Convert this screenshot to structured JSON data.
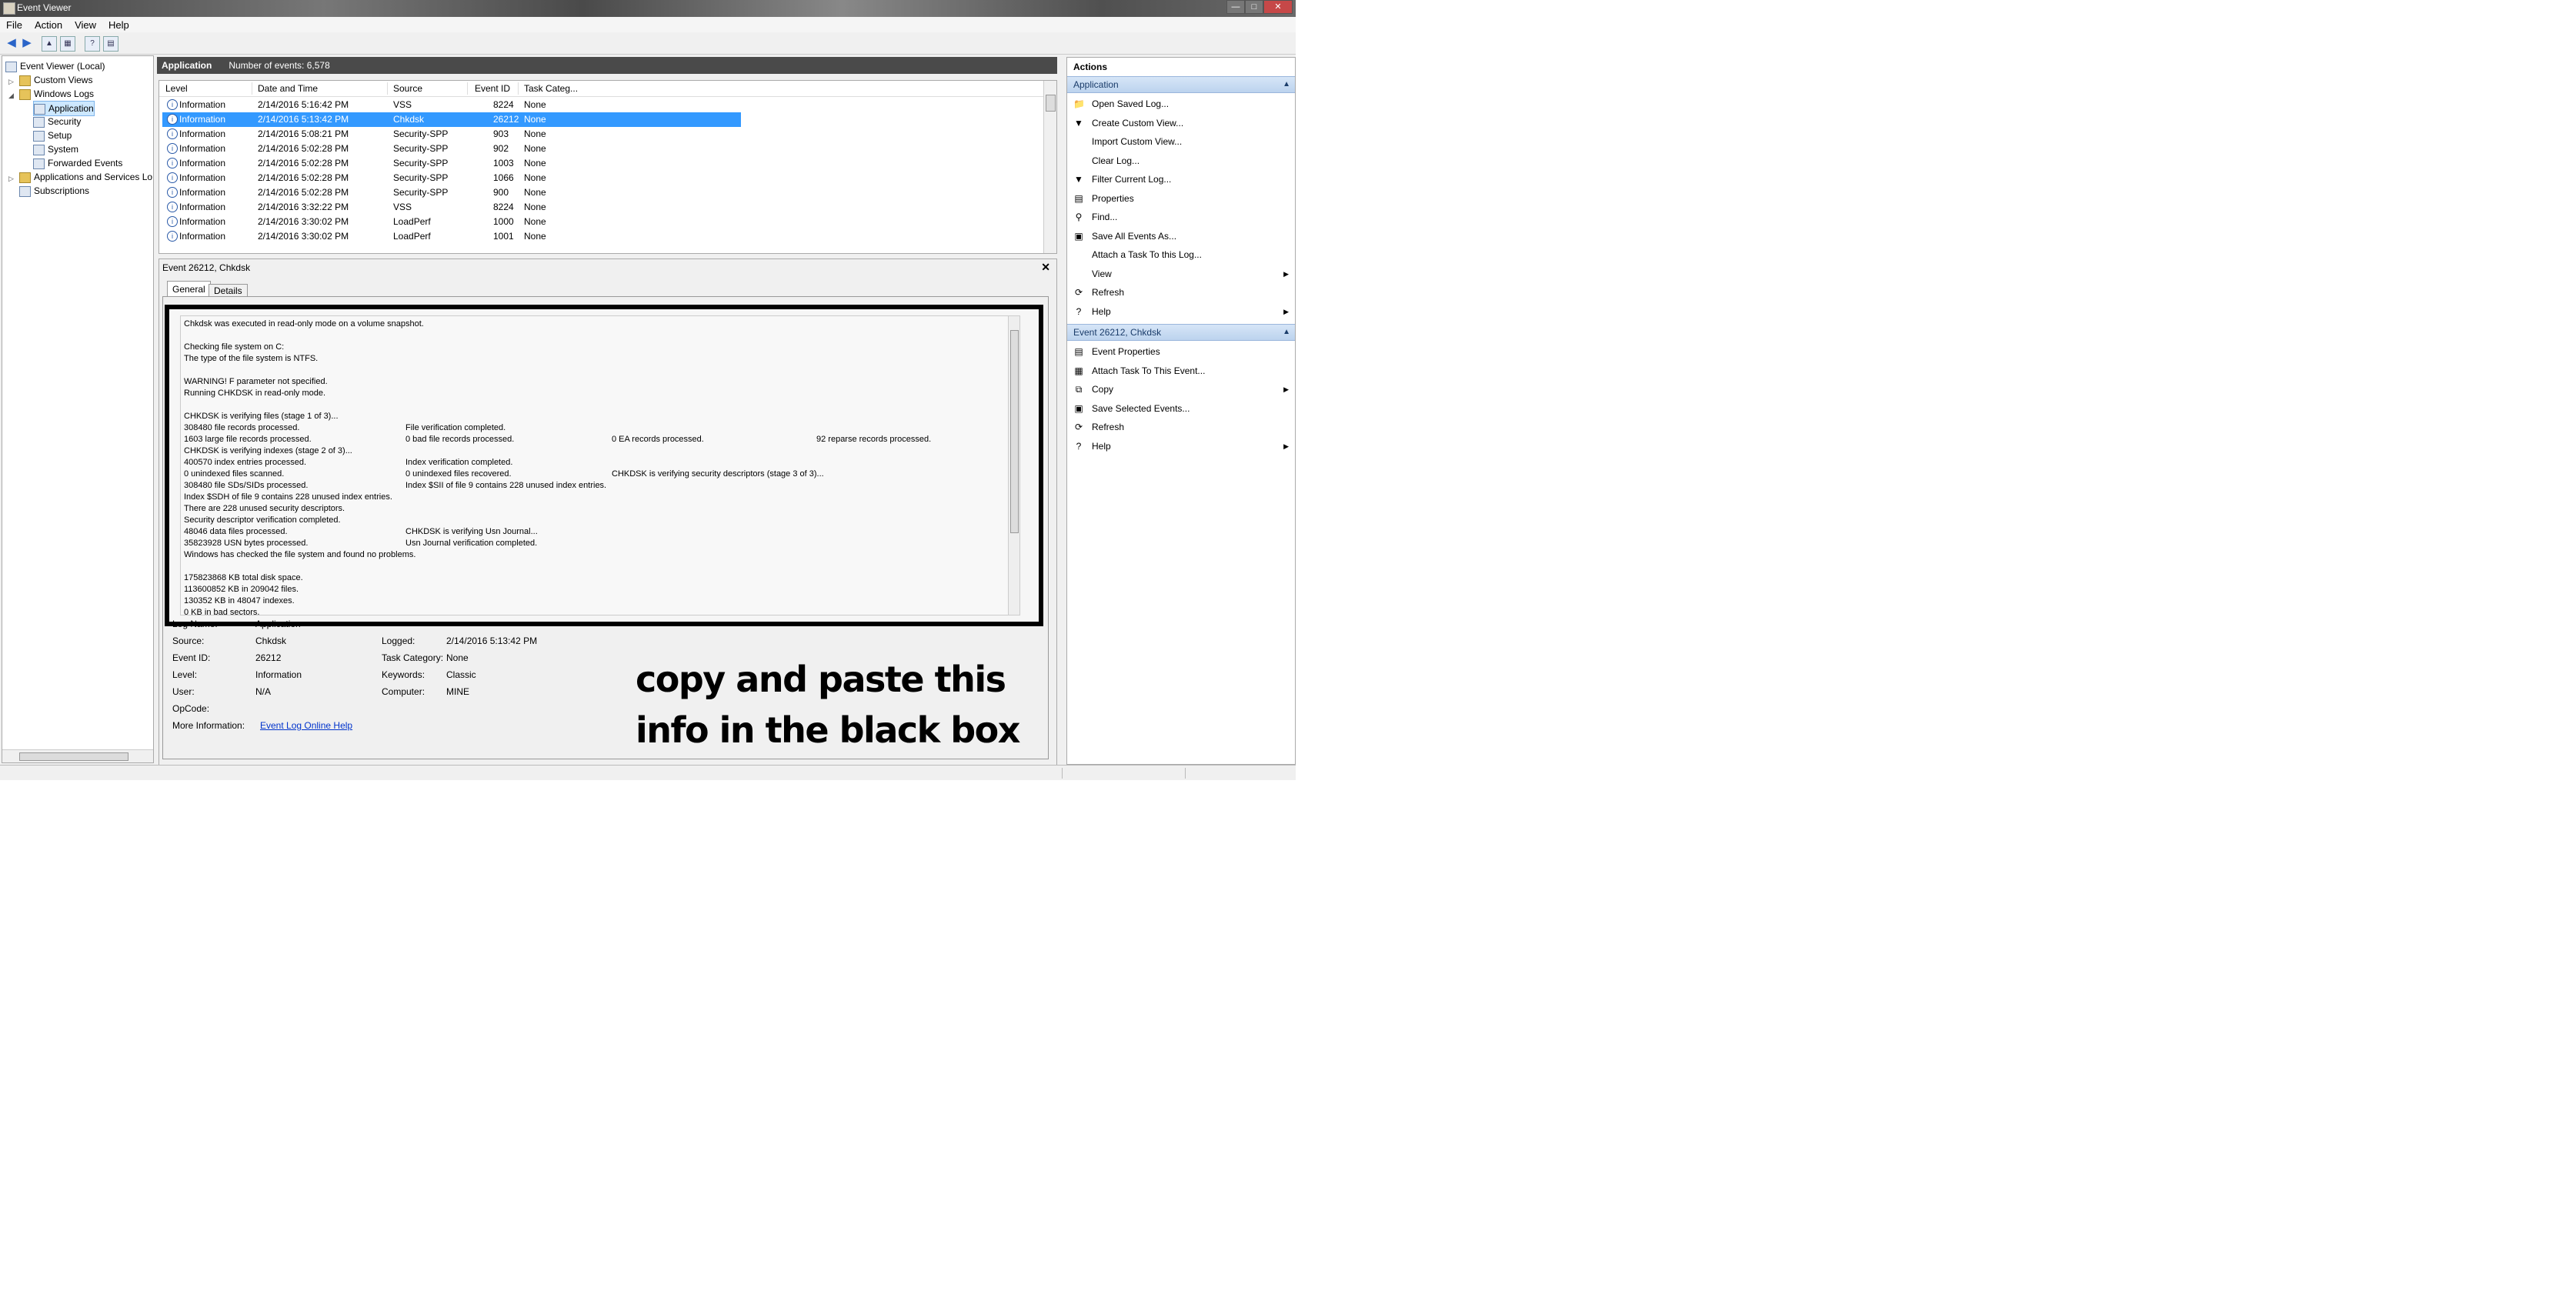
{
  "window": {
    "title": "Event Viewer"
  },
  "menu": [
    "File",
    "Action",
    "View",
    "Help"
  ],
  "tree": {
    "root": "Event Viewer (Local)",
    "custom_views": "Custom Views",
    "windows_logs": "Windows Logs",
    "logs": [
      "Application",
      "Security",
      "Setup",
      "System",
      "Forwarded Events"
    ],
    "apps_services": "Applications and Services Lo",
    "subscriptions": "Subscriptions"
  },
  "pane": {
    "name": "Application",
    "count": "Number of events: 6,578"
  },
  "grid": {
    "headers": [
      "Level",
      "Date and Time",
      "Source",
      "Event ID",
      "Task Categ..."
    ],
    "rows": [
      {
        "level": "Information",
        "date": "2/14/2016 5:16:42 PM",
        "source": "VSS",
        "id": "8224",
        "task": "None"
      },
      {
        "level": "Information",
        "date": "2/14/2016 5:13:42 PM",
        "source": "Chkdsk",
        "id": "26212",
        "task": "None"
      },
      {
        "level": "Information",
        "date": "2/14/2016 5:08:21 PM",
        "source": "Security-SPP",
        "id": "903",
        "task": "None"
      },
      {
        "level": "Information",
        "date": "2/14/2016 5:02:28 PM",
        "source": "Security-SPP",
        "id": "902",
        "task": "None"
      },
      {
        "level": "Information",
        "date": "2/14/2016 5:02:28 PM",
        "source": "Security-SPP",
        "id": "1003",
        "task": "None"
      },
      {
        "level": "Information",
        "date": "2/14/2016 5:02:28 PM",
        "source": "Security-SPP",
        "id": "1066",
        "task": "None"
      },
      {
        "level": "Information",
        "date": "2/14/2016 5:02:28 PM",
        "source": "Security-SPP",
        "id": "900",
        "task": "None"
      },
      {
        "level": "Information",
        "date": "2/14/2016 3:32:22 PM",
        "source": "VSS",
        "id": "8224",
        "task": "None"
      },
      {
        "level": "Information",
        "date": "2/14/2016 3:30:02 PM",
        "source": "LoadPerf",
        "id": "1000",
        "task": "None"
      },
      {
        "level": "Information",
        "date": "2/14/2016 3:30:02 PM",
        "source": "LoadPerf",
        "id": "1001",
        "task": "None"
      }
    ]
  },
  "detail": {
    "title": "Event 26212, Chkdsk",
    "tabs": [
      "General",
      "Details"
    ],
    "message": [
      "Chkdsk was executed in read-only mode on a volume snapshot.",
      "",
      "Checking file system on C:",
      "The type of the file system is NTFS.",
      "",
      "WARNING!  F parameter not specified.",
      "Running CHKDSK in read-only mode.",
      "",
      "CHKDSK is verifying files (stage 1 of 3)...",
      "  308480 file records processed.",
      "  1603 large file records processed.",
      "CHKDSK is verifying indexes (stage 2 of 3)...",
      "  400570 index entries processed.",
      "  0 unindexed files scanned.",
      "  308480 file SDs/SIDs processed.",
      "Index $SDH of file 9 contains 228 unused index entries.",
      "There are 228 unused security descriptors.",
      "Security descriptor verification completed.",
      "  48046 data files processed.",
      "  35823928 USN bytes processed.",
      "Windows has checked the file system and found no problems.",
      "",
      "175823868 KB total disk space.",
      "113600852 KB in 209042 files.",
      "    130352 KB in 48047 indexes.",
      "         0 KB in bad sectors."
    ],
    "message_col2": [
      {
        "line": 9,
        "text": "File verification completed."
      },
      {
        "line": 10,
        "text": "0 bad file records processed."
      },
      {
        "line": 12,
        "text": "Index verification completed."
      },
      {
        "line": 13,
        "text": "0 unindexed files recovered."
      },
      {
        "line": 14,
        "text": "Index $SII of file 9 contains 228 unused index entries."
      },
      {
        "line": 18,
        "text": "CHKDSK is verifying Usn Journal..."
      },
      {
        "line": 19,
        "text": "Usn Journal verification completed."
      }
    ],
    "message_col3": [
      {
        "line": 10,
        "text": "0 EA records processed."
      },
      {
        "line": 13,
        "text": "CHKDSK is verifying security descriptors (stage 3 of 3)..."
      }
    ],
    "message_col4": [
      {
        "line": 10,
        "text": "92 reparse records processed."
      }
    ],
    "props": {
      "log_name_label": "Log Name:",
      "log_name": "Application",
      "source_label": "Source:",
      "source": "Chkdsk",
      "logged_label": "Logged:",
      "logged": "2/14/2016 5:13:42 PM",
      "event_id_label": "Event ID:",
      "event_id": "26212",
      "task_label": "Task Category:",
      "task": "None",
      "level_label": "Level:",
      "level": "Information",
      "keywords_label": "Keywords:",
      "keywords": "Classic",
      "user_label": "User:",
      "user": "N/A",
      "computer_label": "Computer:",
      "computer": "MINE",
      "opcode_label": "OpCode:",
      "more_label": "More Information:",
      "more_link": "Event Log Online Help"
    }
  },
  "annotation": [
    "copy and paste this",
    "info in the black box"
  ],
  "actions": {
    "header": "Actions",
    "section1": "Application",
    "items1": [
      {
        "label": "Open Saved Log...",
        "icon": "folder-icon"
      },
      {
        "label": "Create Custom View...",
        "icon": "filter-icon"
      },
      {
        "label": "Import Custom View...",
        "icon": "none"
      },
      {
        "label": "Clear Log...",
        "icon": "none"
      },
      {
        "label": "Filter Current Log...",
        "icon": "filter-icon"
      },
      {
        "label": "Properties",
        "icon": "properties-icon"
      },
      {
        "label": "Find...",
        "icon": "find-icon"
      },
      {
        "label": "Save All Events As...",
        "icon": "save-icon"
      },
      {
        "label": "Attach a Task To this Log...",
        "icon": "none"
      },
      {
        "label": "View",
        "icon": "none",
        "submenu": true
      },
      {
        "label": "Refresh",
        "icon": "refresh-icon"
      },
      {
        "label": "Help",
        "icon": "help-icon",
        "submenu": true
      }
    ],
    "section2": "Event 26212, Chkdsk",
    "items2": [
      {
        "label": "Event Properties",
        "icon": "properties-icon"
      },
      {
        "label": "Attach Task To This Event...",
        "icon": "task-icon"
      },
      {
        "label": "Copy",
        "icon": "copy-icon",
        "submenu": true
      },
      {
        "label": "Save Selected Events...",
        "icon": "save-icon"
      },
      {
        "label": "Refresh",
        "icon": "refresh-icon"
      },
      {
        "label": "Help",
        "icon": "help-icon",
        "submenu": true
      }
    ]
  }
}
